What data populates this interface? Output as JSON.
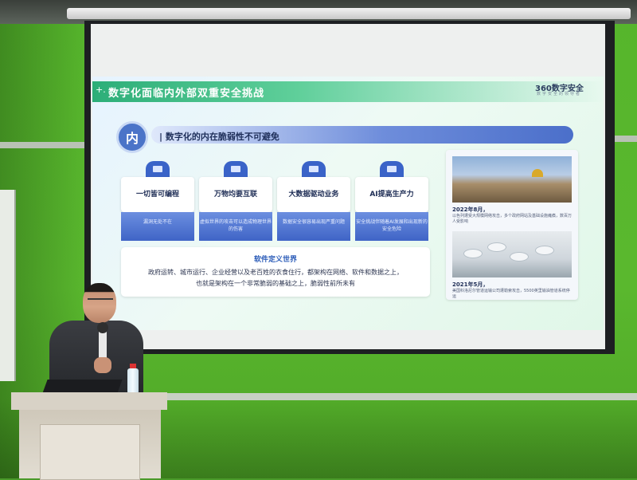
{
  "slide": {
    "title": "数字化面临内外部双重安全挑战",
    "title_prefix": "+.",
    "logo": "360数字安全",
    "logo_sub": "数字安全的领导者",
    "inner_badge": "内",
    "inner_heading": "| 数字化的内在脆弱性不可避免",
    "cards": [
      {
        "title": "一切皆可编程",
        "desc": "漏洞无处不在"
      },
      {
        "title": "万物均要互联",
        "desc": "虚拟世界的攻击可以造成物理世界的伤害"
      },
      {
        "title": "大数据驱动业务",
        "desc": "数据安全很容易出现严重问题"
      },
      {
        "title": "AI提高生产力",
        "desc": "安全挑战伴随着AI发展和出现新的安全危险"
      }
    ],
    "software_title": "软件定义世界",
    "software_line1": "政府运转、城市运行、企业经营以及老百姓的衣食住行，都架构在网络、软件和数据之上，",
    "software_line2": "也就是架构在一个非常脆弱的基础之上，脆弱性前所未有",
    "events": [
      {
        "date": "2022年8月，",
        "note": "以色列遭受大规模网络攻击，多个政府网站及基础设施瘫痪，数百万人受影响"
      },
      {
        "date": "2021年5月，",
        "note": "美国科洛尼尔管道运输公司遭勒索攻击，5500英里输油管道系统停运"
      }
    ]
  },
  "colors": {
    "wall_green": "#56b52c",
    "slide_header": "#2cae78",
    "card_blue": "#3f64c6",
    "badge_blue": "#4b74c8"
  }
}
